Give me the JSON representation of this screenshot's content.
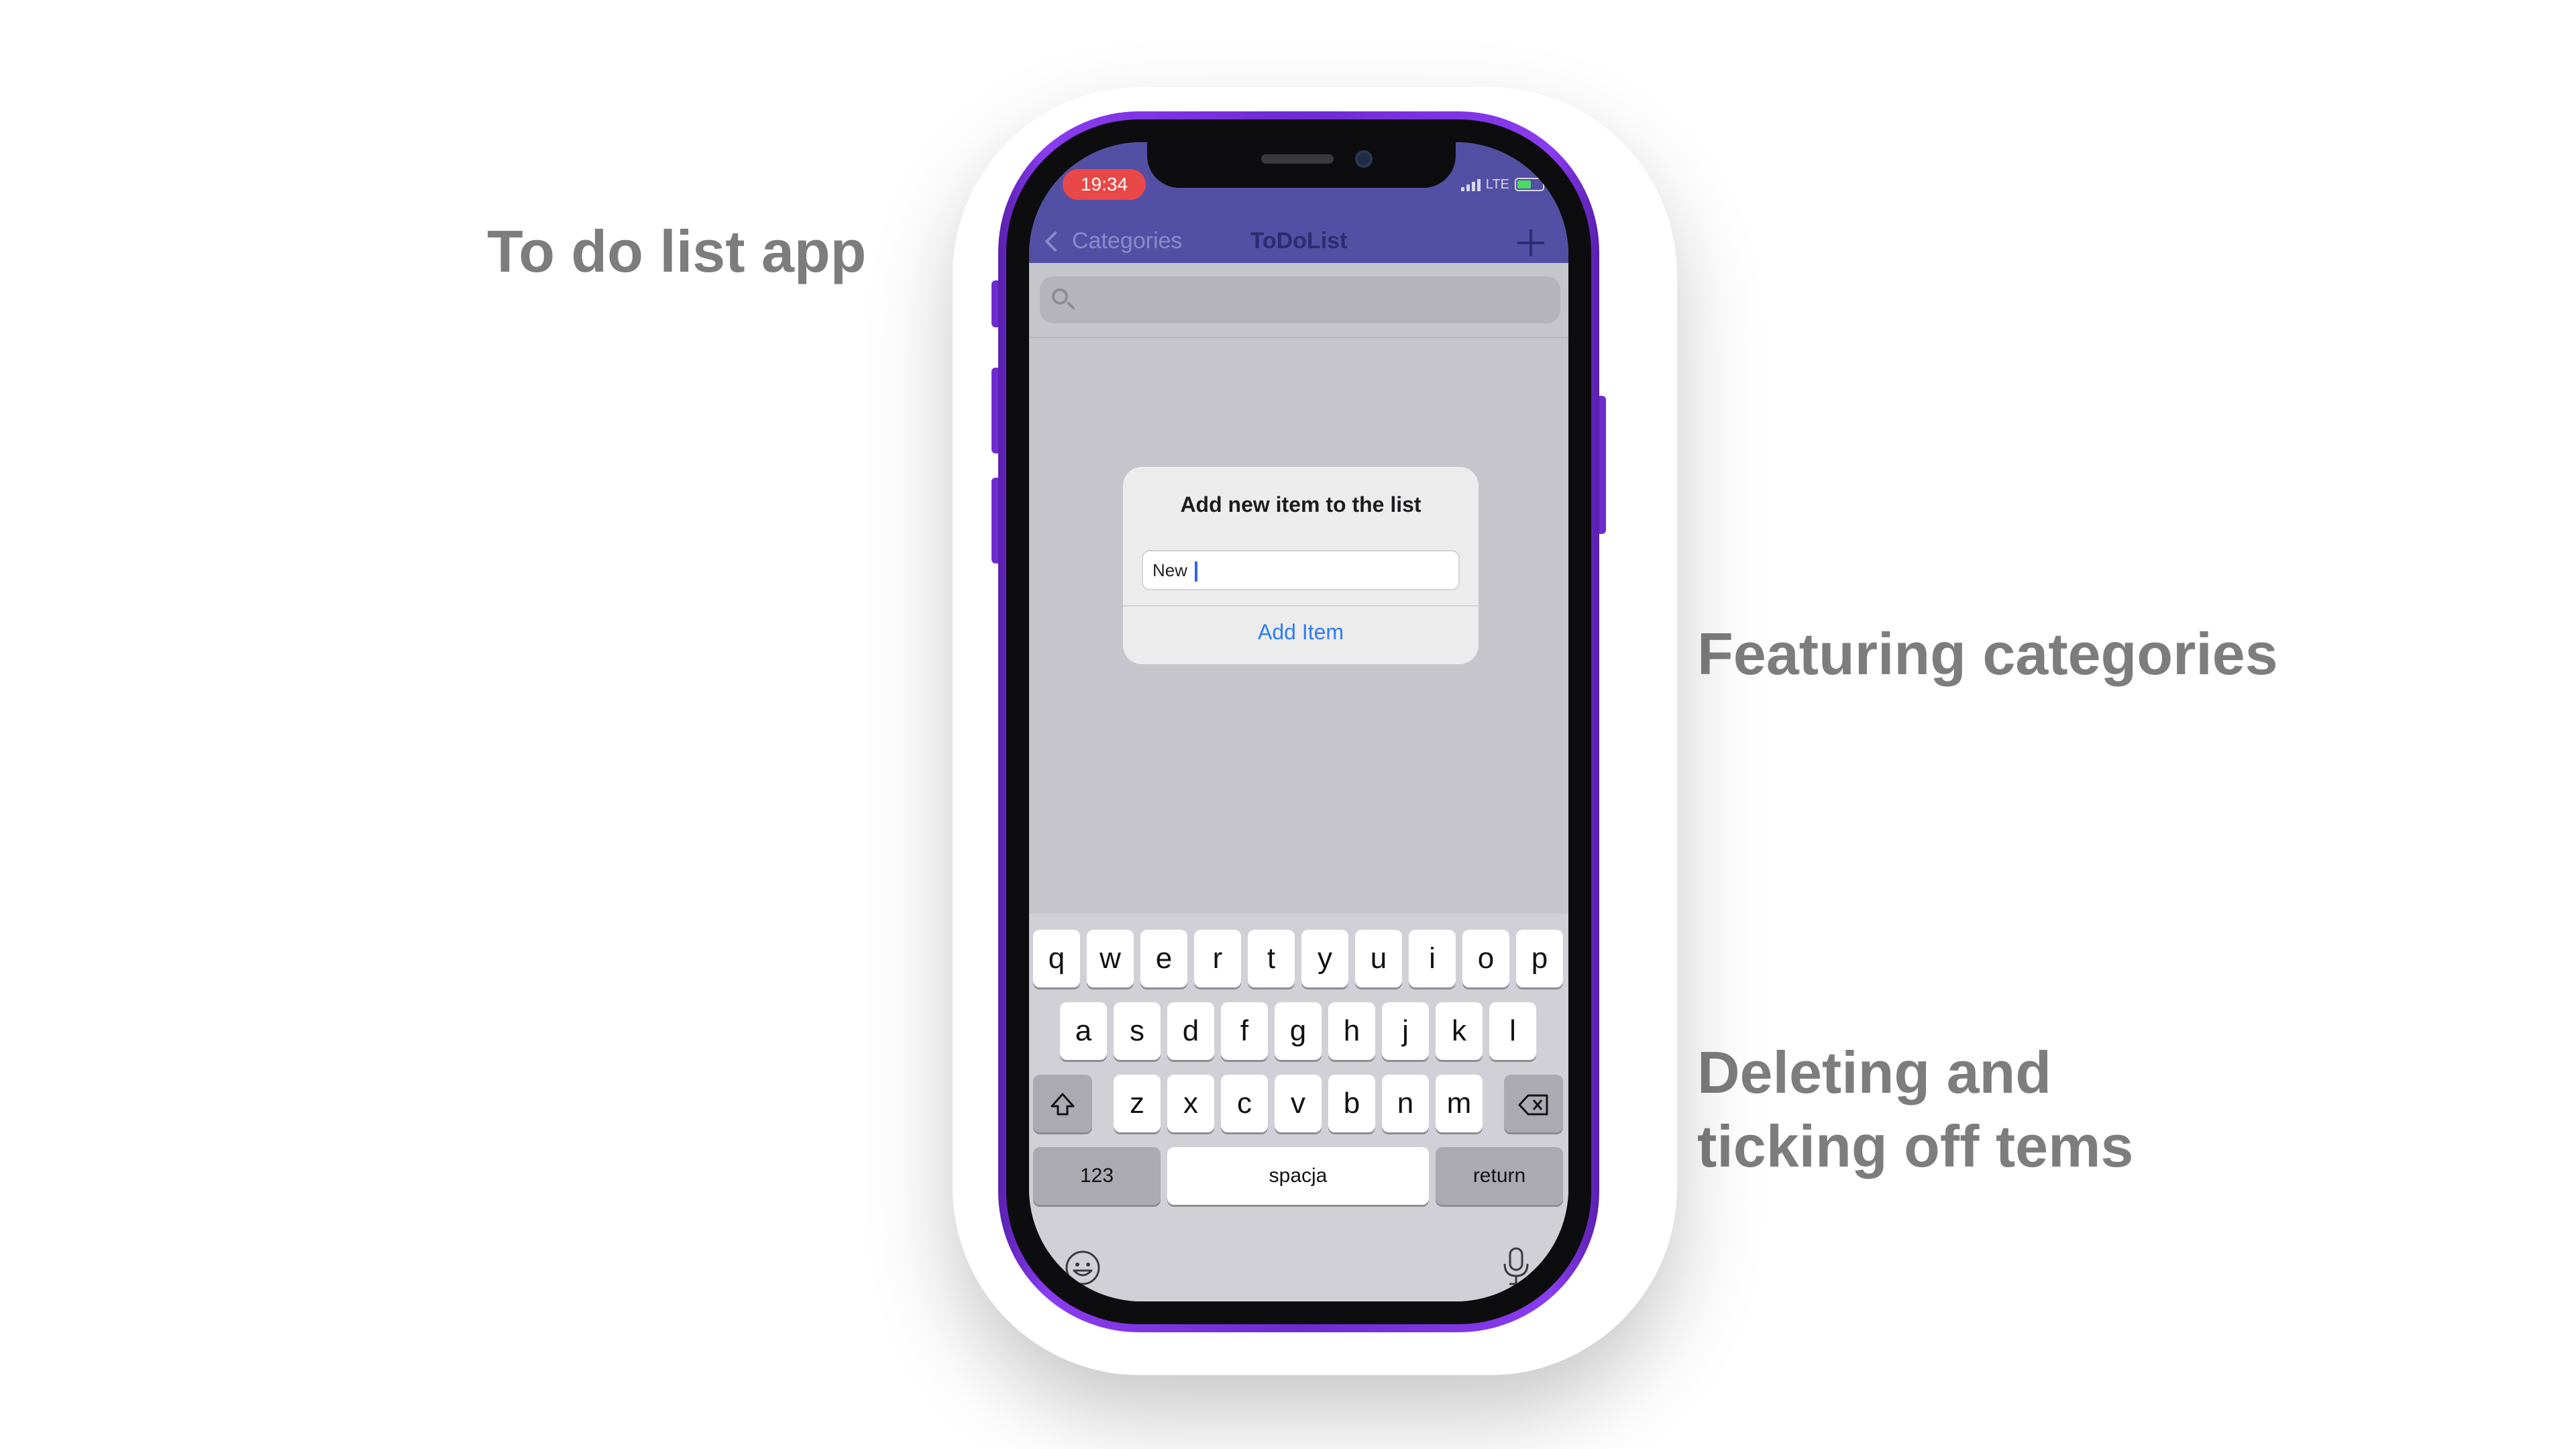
{
  "promo": {
    "line1": "To do list app",
    "line2": "Featuring categories",
    "line3a": "Deleting and",
    "line3b": "ticking off tems"
  },
  "status_bar": {
    "time": "19:34",
    "network": "LTE"
  },
  "nav": {
    "back_label": "Categories",
    "title": "ToDoList"
  },
  "dialog": {
    "title": "Add new item to the list",
    "input_value": "New ",
    "action_label": "Add Item"
  },
  "keyboard": {
    "row1": [
      "q",
      "w",
      "e",
      "r",
      "t",
      "y",
      "u",
      "i",
      "o",
      "p"
    ],
    "row2": [
      "a",
      "s",
      "d",
      "f",
      "g",
      "h",
      "j",
      "k",
      "l"
    ],
    "row3": [
      "z",
      "x",
      "c",
      "v",
      "b",
      "n",
      "m"
    ],
    "numbers_label": "123",
    "space_label": "spacja",
    "return_label": "return"
  },
  "icons": {
    "back": "chevron-left-icon",
    "add": "plus-icon",
    "search": "search-icon",
    "shift": "shift-icon",
    "delete": "backspace-icon",
    "emoji": "emoji-icon",
    "mic": "microphone-icon"
  },
  "colors": {
    "nav_bar": "#534fa5",
    "phone_frame": "#6d2bd0",
    "time_pill": "#e94848",
    "action_blue": "#2f7bf4",
    "promo_text": "#7d7d7d"
  }
}
